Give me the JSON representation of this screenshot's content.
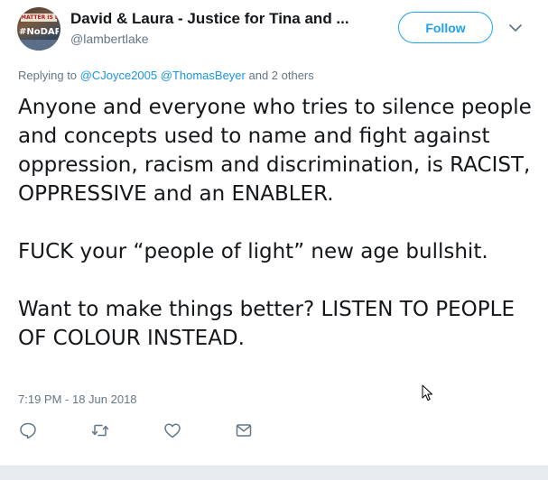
{
  "author": {
    "display_name": "David & Laura - Justice for Tina and ...",
    "handle": "@lambertlake",
    "avatar_banner_text": "MATTER IS LIF",
    "avatar_tag_text": "#NoDAPL"
  },
  "follow_button": {
    "label": "Follow"
  },
  "reply_context": {
    "prefix": "Replying to ",
    "mention_1": "@CJoyce2005",
    "mention_2": "@ThomasBeyer",
    "suffix": " and 2 others"
  },
  "tweet": {
    "paragraph_1": "Anyone and everyone who tries to silence people and concepts used to name and fight against oppression, racism and discrimination, is RACIST, OPPRESSIVE and an ENABLER.",
    "paragraph_2": "FUCK your “people of light” new age bullshit.",
    "paragraph_3": "Want to make things better? LISTEN TO PEOPLE OF COLOUR INSTEAD.",
    "timestamp": "7:19 PM - 18 Jun 2018"
  },
  "actions": [
    {
      "name": "reply",
      "icon": "reply-icon"
    },
    {
      "name": "retweet",
      "icon": "retweet-icon"
    },
    {
      "name": "like",
      "icon": "heart-icon"
    },
    {
      "name": "direct-message",
      "icon": "envelope-icon"
    }
  ],
  "colors": {
    "accent": "#1da1f2",
    "secondary_text": "#657786",
    "primary_text": "#14171a",
    "mention": "#1b95e0"
  }
}
